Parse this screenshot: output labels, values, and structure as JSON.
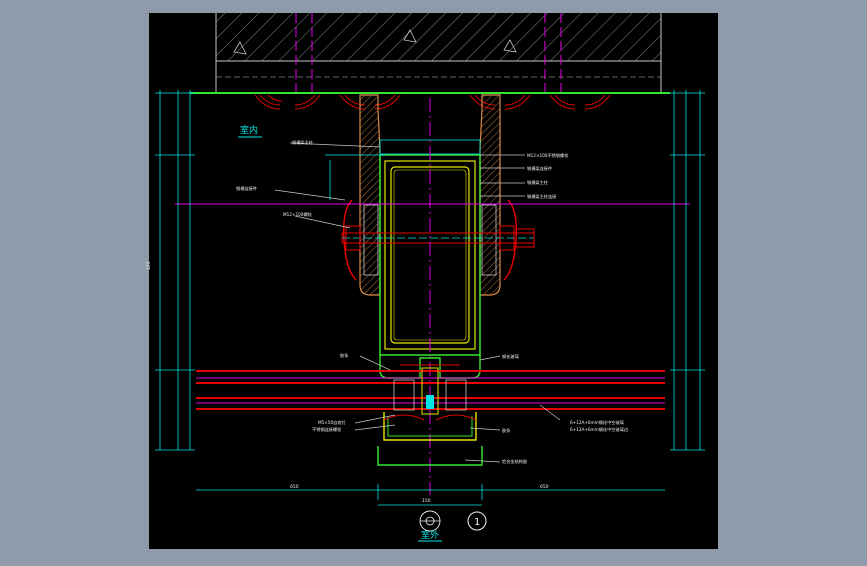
{
  "drawing": {
    "label_indoor": "室内",
    "label_outdoor": "室外",
    "section_number": "1",
    "colors": {
      "viewport_bg": "#8f9aaa",
      "sheet_bg": "#000000",
      "white": "#f2f2f2",
      "yellow": "#e6e600",
      "green": "#33e633",
      "cyan": "#00e6e6",
      "magenta": "#e600e6",
      "red": "#e60000",
      "orange": "#d98c4a"
    },
    "leaders_left": [
      "钢横梁主柱",
      "钢横连接件",
      "M12×100螺栓",
      "胶条",
      "M5×50自攻钉",
      "不锈钢连接螺栓"
    ],
    "leaders_right": [
      "M12×100不锈钢螺栓",
      "钢横梁连接件",
      "钢横梁主柱",
      "钢横梁主柱连接",
      "胶条",
      "钢化玻璃",
      "铝合金结构胶",
      "6+12A+6mm钢化中空玻璃",
      "6+12A+6mm钢化中空玻璃边"
    ],
    "dimensions": [
      "650",
      "650",
      "150",
      "125"
    ]
  }
}
